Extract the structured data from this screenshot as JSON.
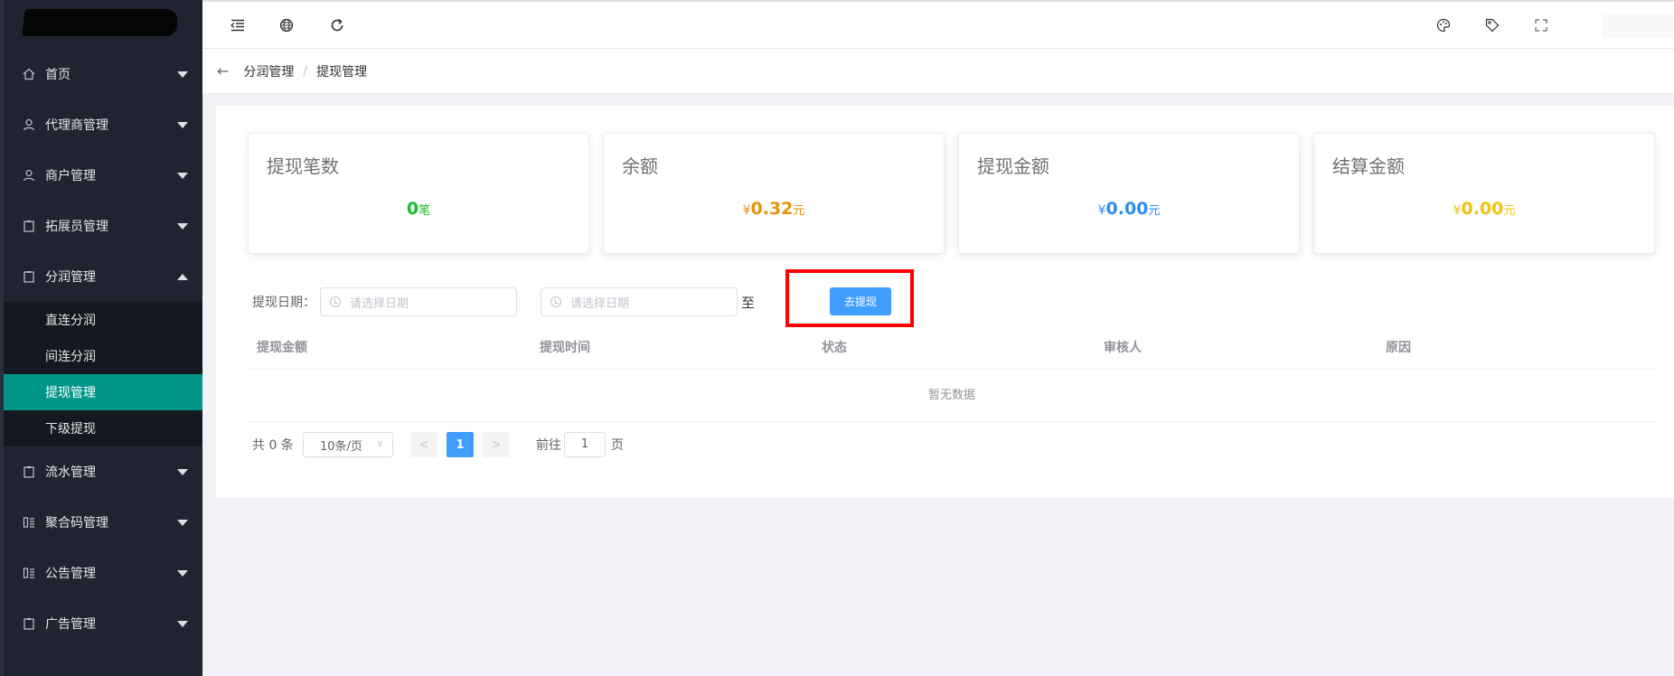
{
  "sidebar": {
    "menu": [
      {
        "label": "首页",
        "icon": "home-icon"
      },
      {
        "label": "代理商管理",
        "icon": "user-icon"
      },
      {
        "label": "商户管理",
        "icon": "user-icon"
      },
      {
        "label": "拓展员管理",
        "icon": "clipboard-icon"
      },
      {
        "label": "分润管理",
        "icon": "clipboard-icon",
        "expanded": true
      }
    ],
    "submenu": [
      {
        "label": "直连分润"
      },
      {
        "label": "间连分润"
      },
      {
        "label": "提现管理",
        "active": true
      },
      {
        "label": "下级提现"
      }
    ],
    "menu_after": [
      {
        "label": "流水管理",
        "icon": "clipboard-icon"
      },
      {
        "label": "聚合码管理",
        "icon": "columns-icon"
      },
      {
        "label": "公告管理",
        "icon": "columns-icon"
      },
      {
        "label": "广告管理",
        "icon": "clipboard-icon"
      }
    ],
    "active_color": "#009688"
  },
  "breadcrumb": {
    "parent": "分润管理",
    "separator": "/",
    "current": "提现管理"
  },
  "stats": [
    {
      "title": "提现笔数",
      "currency": "",
      "value": "0",
      "unit": "笔",
      "color": "#19be2b"
    },
    {
      "title": "余额",
      "currency": "¥",
      "value": "0.32",
      "unit": "元",
      "color": "#e6910e"
    },
    {
      "title": "提现金额",
      "currency": "¥",
      "value": "0.00",
      "unit": "元",
      "color": "#2d8cf0"
    },
    {
      "title": "结算金额",
      "currency": "¥",
      "value": "0.00",
      "unit": "元",
      "color": "#f2c00f"
    }
  ],
  "filter": {
    "label": "提现日期：",
    "start_placeholder": "请选择日期",
    "to": "至",
    "end_placeholder": "请选择日期",
    "withdraw_button": "去提现"
  },
  "table": {
    "columns": [
      "提现金额",
      "提现时间",
      "状态",
      "审核人",
      "原因"
    ],
    "empty_text": "暂无数据"
  },
  "pagination": {
    "total_text": "共 0 条",
    "page_size": "10条/页",
    "prev": "<",
    "current_page": "1",
    "next": ">",
    "goto_prefix": "前往",
    "goto_value": "1",
    "goto_suffix": "页"
  },
  "accent_color": "#409eff"
}
